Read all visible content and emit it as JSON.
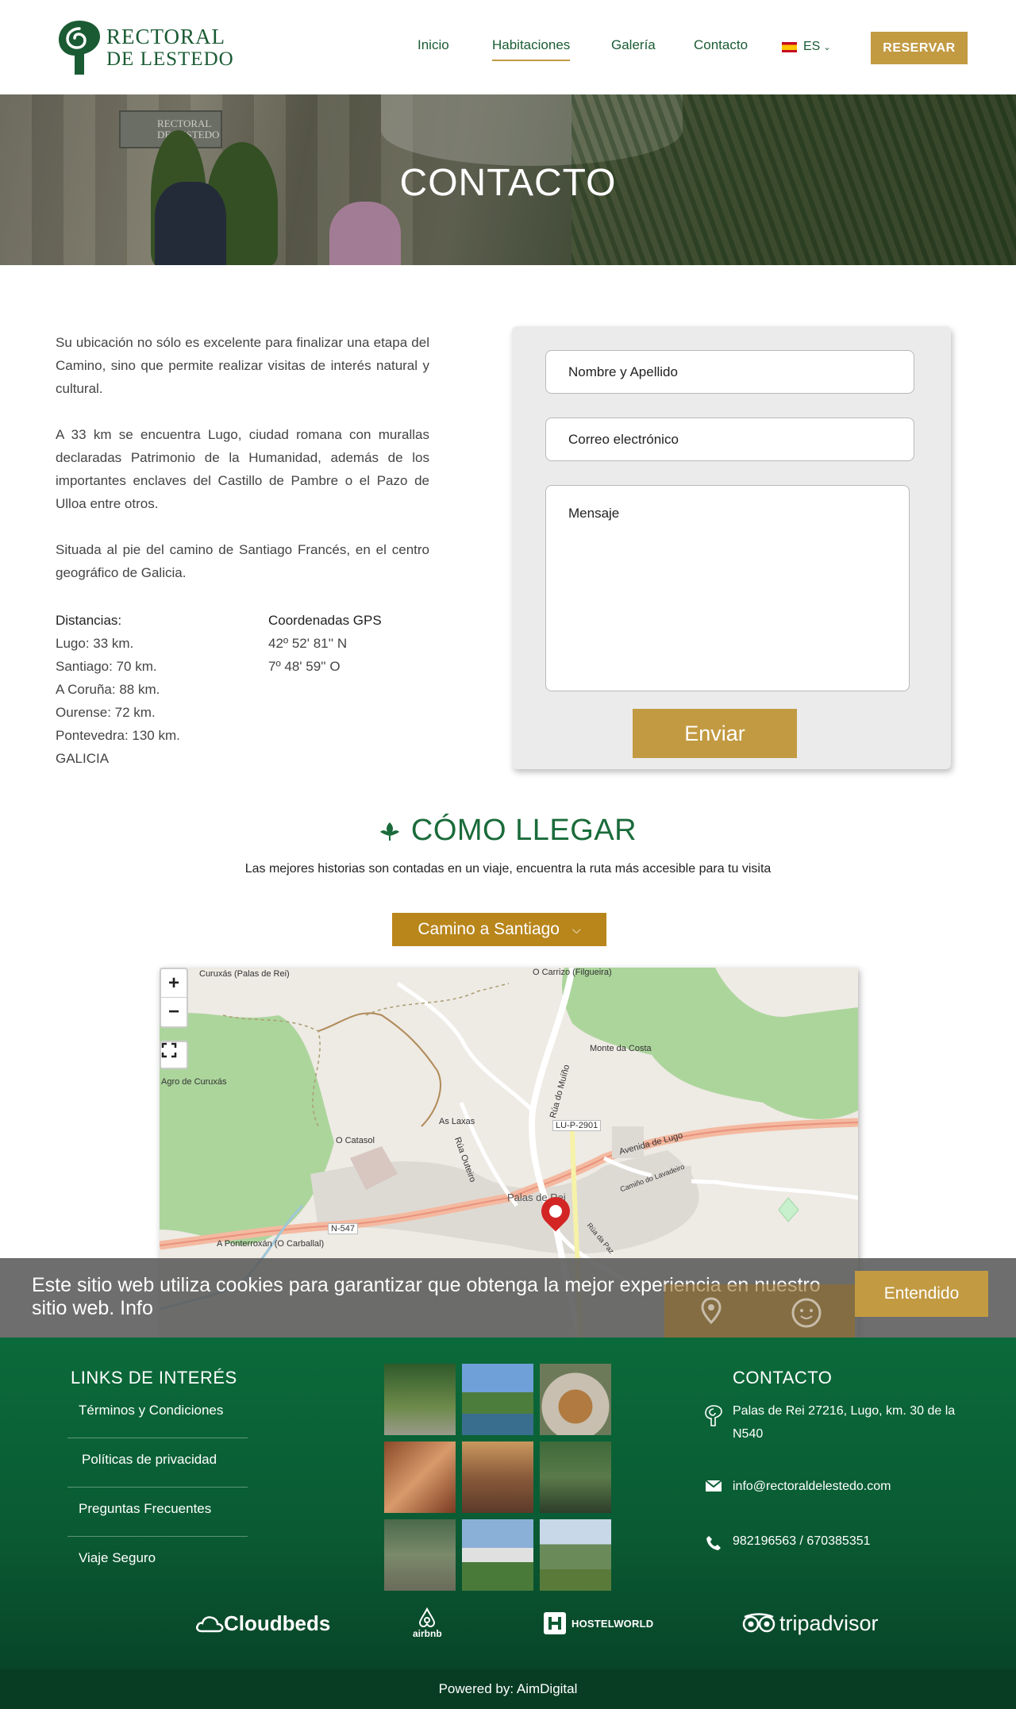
{
  "brand": {
    "name_line1": "RECTORAL",
    "name_line2": "DE LESTEDO"
  },
  "nav": {
    "items": [
      "Inicio",
      "Habitaciones",
      "Galería",
      "Contacto"
    ],
    "language": "ES",
    "reserve": "RESERVAR"
  },
  "banner": {
    "title": "CONTACTO",
    "sign_line1": "RECTORAL",
    "sign_line2": "DE LESTEDO"
  },
  "intro": {
    "p1": "Su ubicación no sólo es excelente para finalizar una etapa del Camino, sino que permite realizar visitas de interés natural y cultural.",
    "p2": "A 33 km se encuentra Lugo, ciudad romana con murallas declaradas Patrimonio de la Humanidad, además de los importantes enclaves del Castillo de Pambre o el Pazo de Ulloa entre otros.",
    "p3": "Situada al pie del camino de Santiago Francés, en el centro geográfico de Galicia."
  },
  "distances": {
    "title": "Distancias:",
    "items": [
      "Lugo: 33 km.",
      "Santiago: 70 km.",
      "A Coruña: 88 km.",
      "Ourense: 72 km.",
      "Pontevedra: 130 km.",
      "GALICIA"
    ]
  },
  "gps": {
    "title": "Coordenadas GPS",
    "lat": "42º 52' 81'' N",
    "lon": "7º 48' 59'' O"
  },
  "form": {
    "name_placeholder": "Nombre y Apellido",
    "email_placeholder": "Correo electrónico",
    "message_placeholder": "Mensaje",
    "submit": "Enviar"
  },
  "how": {
    "title": "CÓMO LLEGAR",
    "subtitle": "Las mejores historias son contadas en un viaje, encuentra la ruta más accesible para tu visita",
    "route_select": "Camino a Santiago"
  },
  "map": {
    "labels": [
      "Curuxás (Palas de Rei)",
      "O Carrizo (Filgueira)",
      "Monte da Costa",
      "Agro de Curuxás",
      "As Laxas",
      "O Catasol",
      "Rúa do Muíño",
      "LU-P-2901",
      "Avenida de Lugo",
      "Camiño do Lavadeiro",
      "Palas de Rei",
      "Rúa Outeiro",
      "N-547",
      "A Ponterroxán (O Carballal)",
      "Rúa da Paz"
    ],
    "zoom_in": "+",
    "zoom_out": "−"
  },
  "cookie": {
    "message": "Este sitio web utiliza cookies para garantizar que obtenga la mejor experiencia en nuestro sitio web. Info",
    "accept": "Entendido"
  },
  "footer": {
    "links_title": "LINKS DE INTERÉS",
    "links": [
      "Términos y Condiciones",
      "Políticas de privacidad",
      "Preguntas Frecuentes",
      "Viaje Seguro"
    ],
    "contact_title": "CONTACTO",
    "address": "Palas de Rei 27216, Lugo, km. 30 de la N540",
    "email": "info@rectoraldelestedo.com",
    "phone": "982196563 / 670385351",
    "partners": [
      "Cloudbeds",
      "airbnb",
      "HOSTELWORLD",
      "tripadvisor"
    ],
    "powered": "Powered by: AimDigital"
  },
  "colors": {
    "green": "#1a5b34",
    "gold": "#c29a42",
    "footer": "#0b6a3a"
  }
}
